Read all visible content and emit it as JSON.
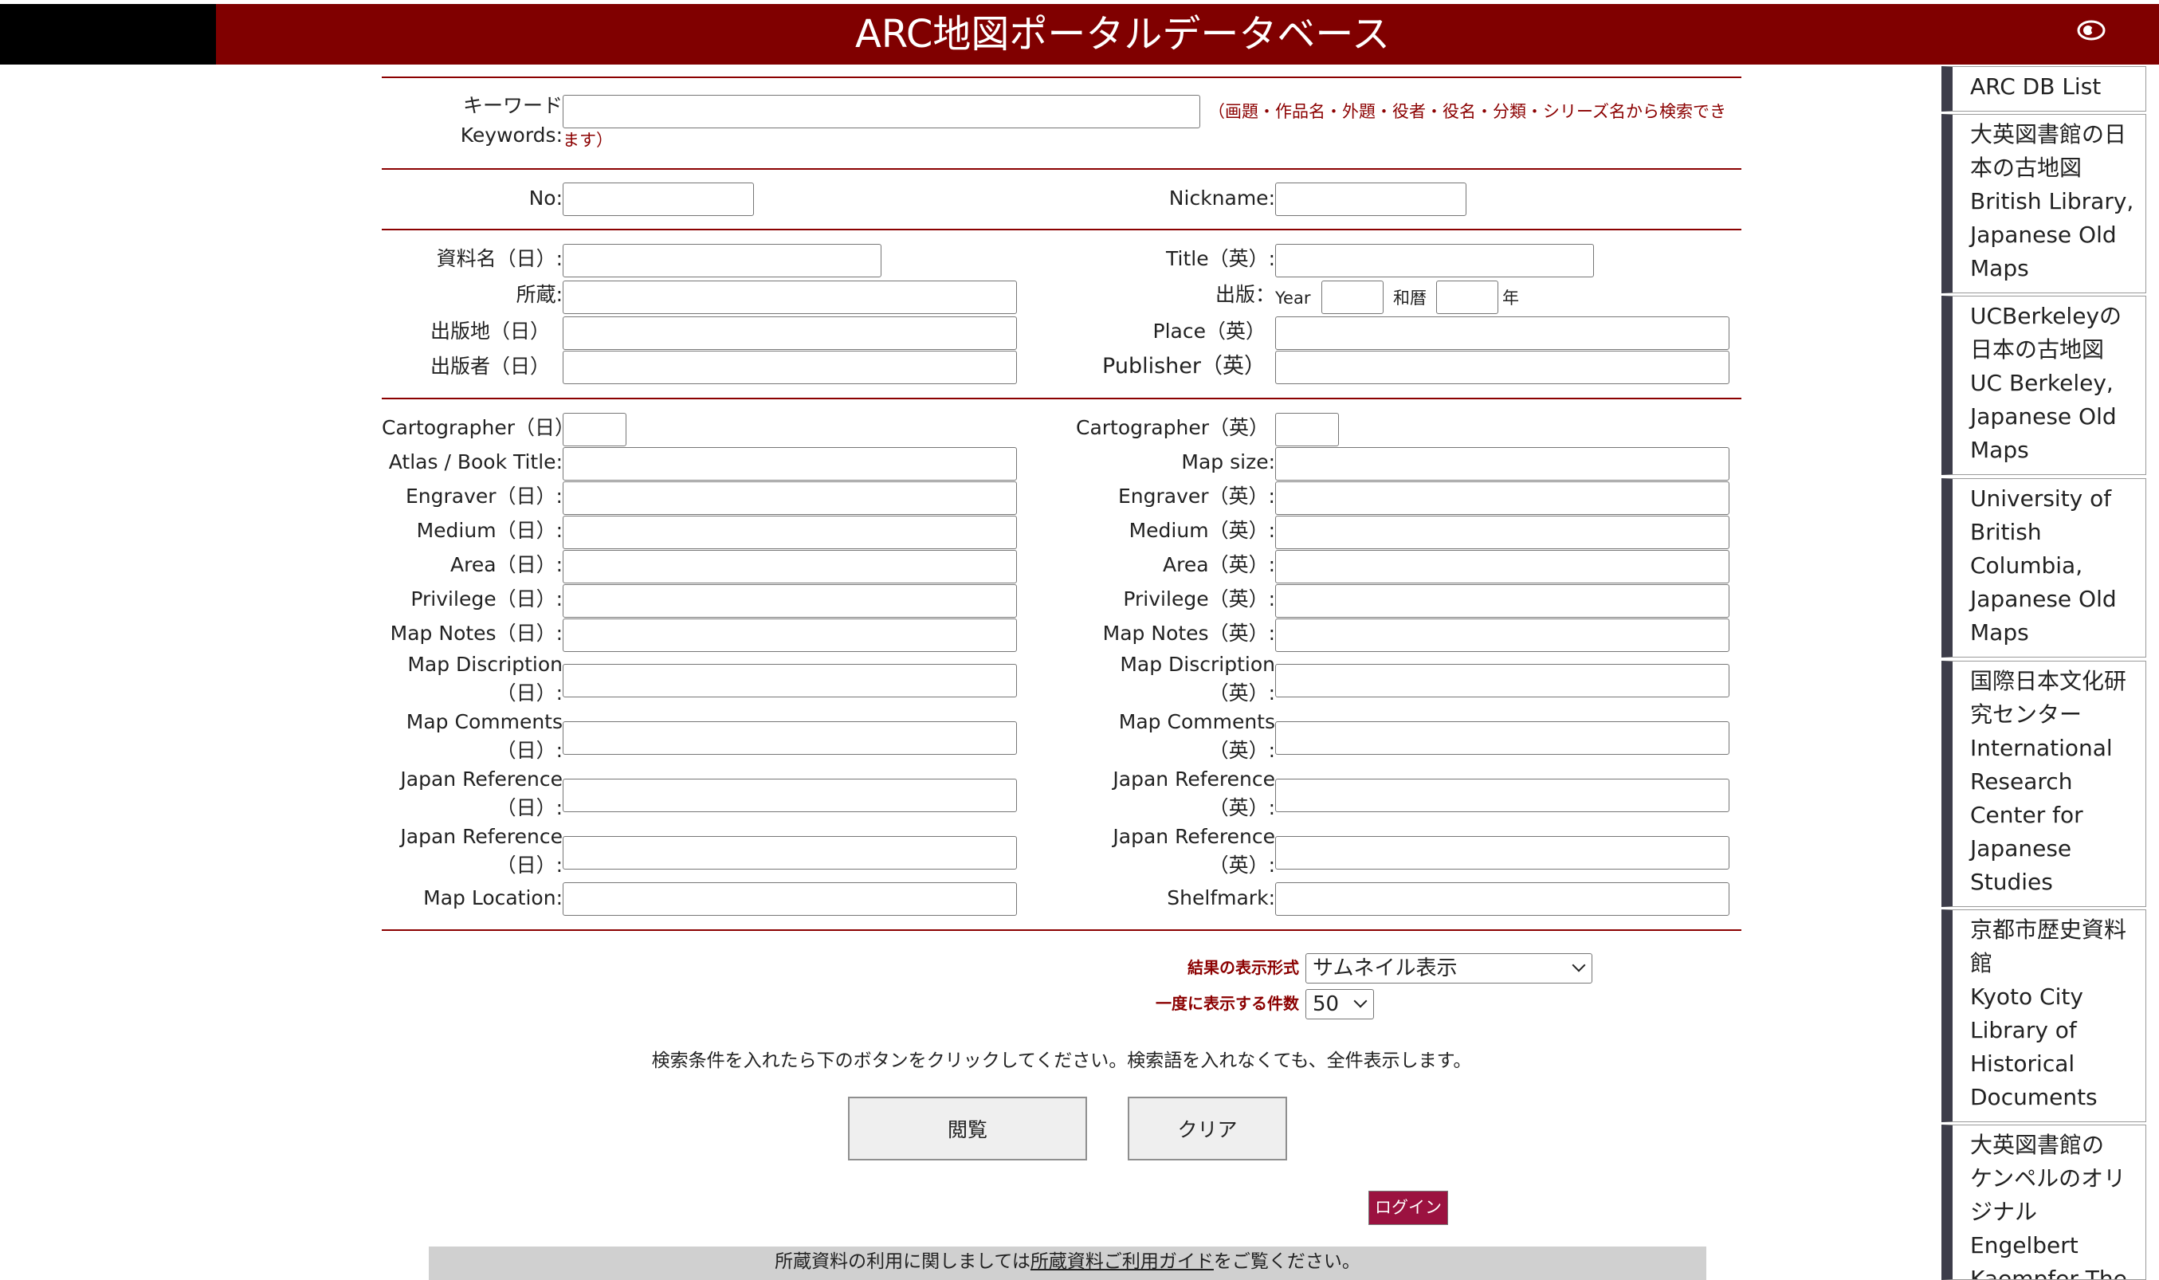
{
  "header": {
    "title": "ARC地図ポータルデータベース"
  },
  "keyword": {
    "label_ja": "キーワード",
    "label_en": "Keywords:",
    "note": "（画題・作品名・外題・役者・役名・分類・シリーズ名から検索できます）",
    "note_a": "（画題・作品名・外題・役者・役名・分類・シリーズ名から検索でき",
    "note_b": "ます）"
  },
  "row_no": {
    "no_label": "No:",
    "nickname_label": "Nickname:"
  },
  "left_fields_1": [
    {
      "label": "資料名（日）:"
    },
    {
      "label": "所蔵:"
    },
    {
      "label": "出版地（日）"
    },
    {
      "label": "出版者（日）"
    }
  ],
  "right_fields_1": {
    "title_label": "Title（英）:",
    "publish_label": "出版：",
    "year_label": "Year",
    "wareki_label": "和暦",
    "nen_label": "年",
    "place_label": "Place（英）",
    "publisher_label": "Publisher（英）"
  },
  "left_fields_2": [
    "Cartographer（日）",
    "Atlas / Book Title:",
    "Engraver（日）:",
    "Medium（日）:",
    "Area（日）:",
    "Privilege（日）:",
    "Map Notes（日）:"
  ],
  "right_fields_2": [
    "Cartographer（英）",
    "Map size:",
    "Engraver（英）:",
    "Medium（英）:",
    "Area（英）:",
    "Privilege（英）:",
    "Map Notes（英）:"
  ],
  "left_two_line": [
    {
      "l1": "Map Discription",
      "l2": "（日）:"
    },
    {
      "l1": "Map Comments",
      "l2": "（日）:"
    },
    {
      "l1": "Japan Reference",
      "l2": "（日）:"
    },
    {
      "l1": "Japan Reference",
      "l2": "（日）:"
    }
  ],
  "right_two_line": [
    {
      "l1": "Map Discription",
      "l2": "（英）:"
    },
    {
      "l1": "Map Comments",
      "l2": "（英）:"
    },
    {
      "l1": "Japan Reference",
      "l2": "（英）:"
    },
    {
      "l1": "Japan Reference",
      "l2": "（英）:"
    }
  ],
  "last_row": {
    "left_label": "Map Location:",
    "right_label": "Shelfmark:"
  },
  "display": {
    "format_label": "結果の表示形式",
    "format_value": "サムネイル表示",
    "count_label": "一度に表示する件数",
    "count_value": "50"
  },
  "instruction": "検索条件を入れたら下のボタンをクリックしてください。検索語を入れなくても、全件表示します。",
  "buttons": {
    "browse": "閲覧",
    "clear": "クリア",
    "login": "ログイン"
  },
  "footer": {
    "pre": "所蔵資料の利用に関しましては",
    "link": "所蔵資料ご利用ガイド",
    "post": "をご覧ください。"
  },
  "sidebar": {
    "items": [
      {
        "lines": [
          "ARC DB List"
        ]
      },
      {
        "lines": [
          "大英図書館の日",
          "本の古地図",
          "British Library,",
          "Japanese Old",
          "Maps"
        ]
      },
      {
        "lines": [
          "UCBerkeleyの",
          "日本の古地図",
          "UC Berkeley,",
          "Japanese Old",
          "Maps"
        ]
      },
      {
        "lines": [
          "University of",
          "British",
          "Columbia,",
          "Japanese Old",
          "Maps"
        ]
      },
      {
        "lines": [
          "国際日本文化研",
          "究センター",
          "International",
          "Research",
          "Center for",
          "Japanese",
          "Studies"
        ]
      },
      {
        "lines": [
          "京都市歴史資料",
          "館",
          "Kyoto City",
          "Library of",
          "Historical",
          "Documents"
        ]
      },
      {
        "lines": [
          "大英図書館の",
          "ケンペルのオリ",
          "ジナル",
          "Engelbert",
          "Kaempfer The"
        ]
      }
    ]
  }
}
